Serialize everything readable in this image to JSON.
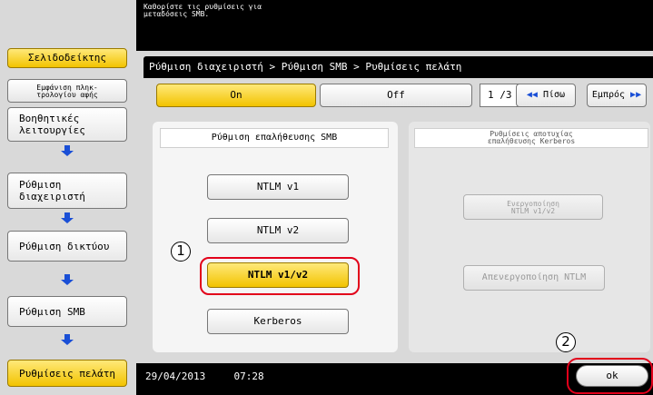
{
  "topbar": {
    "message_line1": "Καθορίστε τις ρυθμίσεις για",
    "message_line2": "μεταδόσεις SMB."
  },
  "sidebar": {
    "bookmark_label": "Σελιδοδείκτης",
    "display_label_line1": "Εμφάνιση πληκ-",
    "display_label_line2": "τρολογίου αφής",
    "items": [
      {
        "line1": "Βοηθητικές",
        "line2": "λειτουργίες"
      },
      {
        "line1": "Ρύθμιση",
        "line2": "διαχειριστή"
      },
      {
        "line1": "Ρύθμιση δικτύου",
        "line2": ""
      },
      {
        "line1": "Ρύθμιση SMB",
        "line2": ""
      },
      {
        "line1": "Ρυθμίσεις πελάτη",
        "line2": ""
      }
    ]
  },
  "breadcrumb": "Ρύθμιση διαχειριστή > Ρύθμιση SMB > Ρυθμίσεις πελάτη",
  "toggle": {
    "on_label": "On",
    "off_label": "Off",
    "selected": "On"
  },
  "pagination": {
    "page": "1 /3",
    "prev_label": "Πίσω",
    "next_label": "Εμπρός"
  },
  "auth_panel": {
    "title": "Ρύθμιση επαλήθευσης SMB",
    "options": [
      "NTLM v1",
      "NTLM v2",
      "NTLM v1/v2",
      "Kerberos"
    ],
    "selected": "NTLM v1/v2"
  },
  "kerberos_panel": {
    "title_line1": "Ρυθμίσεις αποτυχίας",
    "title_line2": "επαλήθευσης Kerberos",
    "enable_line1": "Ενεργοποίηση",
    "enable_line2": "NTLM v1/v2",
    "disable_label": "Απενεργοποίηση NTLM"
  },
  "callouts": {
    "first": "1",
    "second": "2"
  },
  "status": {
    "date": "29/04/2013",
    "time": "07:28"
  },
  "ok_label": "ok",
  "colors": {
    "highlight": "#f2c300",
    "annotation_red": "#e2001a",
    "arrow_blue": "#1a4fd6"
  }
}
